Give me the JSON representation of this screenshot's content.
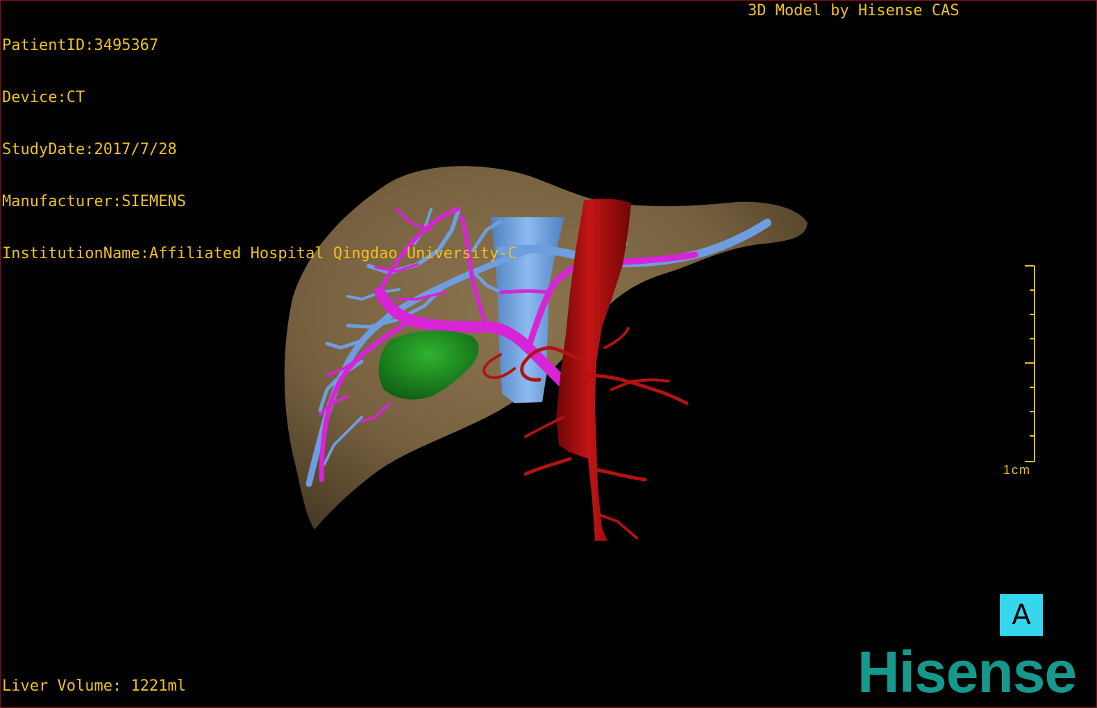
{
  "header": {
    "patient_id": "PatientID:3495367",
    "device": "Device:CT",
    "study_date": "StudyDate:2017/7/28",
    "manufacturer": "Manufacturer:SIEMENS",
    "institution": "InstitutionName:Affiliated Hospital Qingdao University-C"
  },
  "brand_caption": "3D Model by Hisense CAS",
  "volume": "Liver Volume: 1221ml",
  "scale_bar": {
    "label": "1cm"
  },
  "orientation": {
    "label": "A"
  },
  "logo": {
    "text": "Hisense"
  },
  "colors": {
    "overlay_text": "#f0c020",
    "liver": "#7a6443",
    "portal_vein": "#d61fd6",
    "hepatic_vein": "#5d8fd6",
    "vena_cava": "#6fa7e6",
    "aorta": "#a80d0d",
    "tumor": "#1f8f1f",
    "orientation_bg": "#34d7ee",
    "logo": "#14998c"
  }
}
